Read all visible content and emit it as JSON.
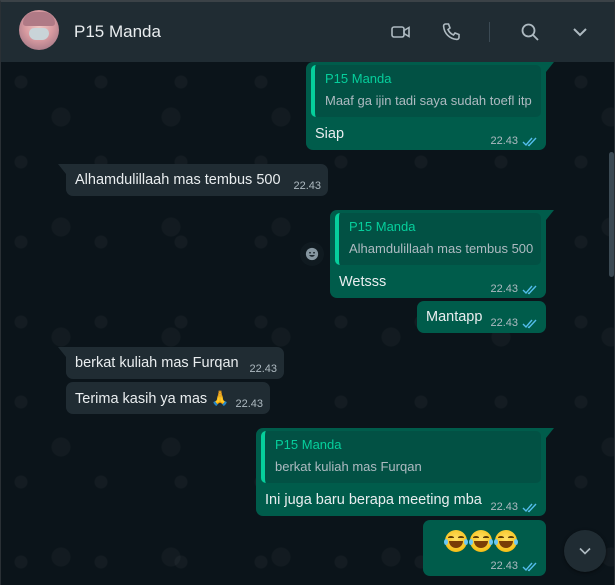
{
  "header": {
    "contact_name": "P15 Manda",
    "icons": [
      "video-call-icon",
      "voice-call-icon",
      "search-icon",
      "chevron-down-icon"
    ]
  },
  "colors": {
    "header_bg": "#202c33",
    "chat_bg": "#0b141a",
    "outgoing_bubble": "#005c4b",
    "incoming_bubble": "#202c33",
    "quote_accent": "#06cf9c",
    "read_ticks": "#53bdeb"
  },
  "messages": [
    {
      "direction": "out",
      "quote": {
        "name": "P15 Manda",
        "text": "Maaf ga ijin tadi saya sudah toefl itp"
      },
      "text": "Siap",
      "time": "22.43",
      "status": "read"
    },
    {
      "direction": "in",
      "text": "Alhamdulillaah mas tembus 500",
      "time": "22.43"
    },
    {
      "direction": "out",
      "quote": {
        "name": "P15 Manda",
        "text": "Alhamdulillaah mas tembus 500"
      },
      "text": "Wetsss",
      "time": "22.43",
      "status": "read"
    },
    {
      "direction": "out",
      "text": "Mantapp",
      "time": "22.43",
      "status": "read"
    },
    {
      "direction": "in",
      "text": "berkat kuliah mas Furqan",
      "time": "22.43"
    },
    {
      "direction": "in",
      "text": "Terima kasih ya mas 🙏",
      "time": "22.43"
    },
    {
      "direction": "out",
      "quote": {
        "name": "P15 Manda",
        "text": "berkat kuliah mas Furqan"
      },
      "text": "Ini juga baru berapa meeting mba",
      "time": "22.43",
      "status": "read"
    },
    {
      "direction": "out",
      "text": "😆😆😆",
      "time": "22.43",
      "status": "read"
    }
  ],
  "floating": {
    "reaction_icon": "emoji-react-icon",
    "scroll_down_icon": "chevron-down-icon"
  }
}
